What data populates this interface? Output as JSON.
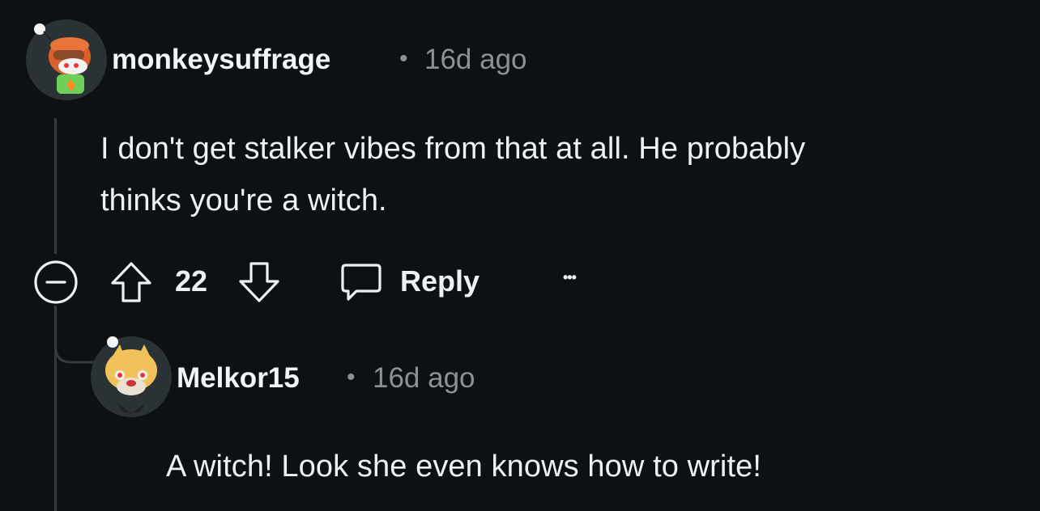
{
  "comments": [
    {
      "username": "monkeysuffrage",
      "separator": "•",
      "time": "16d ago",
      "text_line1": "I don't get stalker vibes from that at all. He probably",
      "text_line2": "thinks you're a witch.",
      "score": "22",
      "reply_label": "Reply",
      "more_label": "•••"
    },
    {
      "username": "Melkor15",
      "separator": "•",
      "time": "16d ago",
      "text": "A witch! Look she even knows how to write!"
    }
  ],
  "colors": {
    "background": "#0e1113",
    "text": "#eef1f3",
    "meta": "#8a9297",
    "thread_line": "#33393d"
  }
}
